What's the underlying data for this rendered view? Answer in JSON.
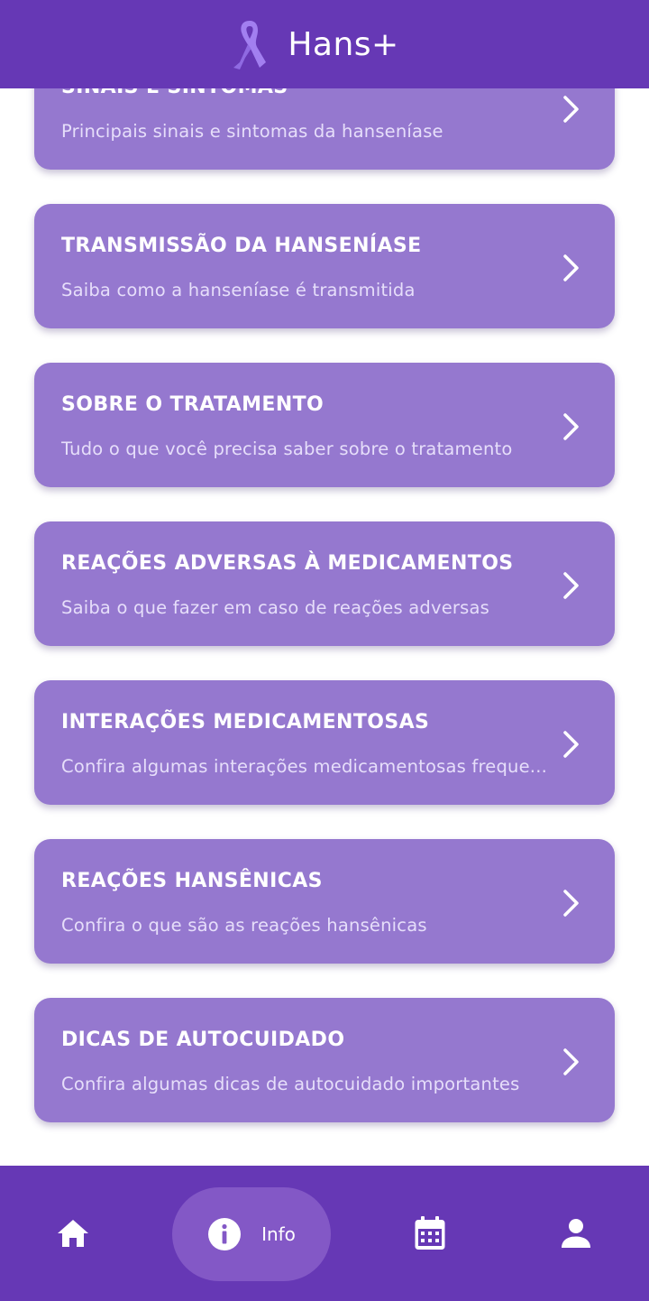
{
  "app": {
    "title": "Hans+",
    "ribbon_icon": "awareness-ribbon-icon",
    "colors": {
      "header_bg": "#6638b5",
      "card_bg": "#9578cf",
      "ribbon": "#a27ff0",
      "active_tab_bg": "#8358c6"
    }
  },
  "cards": [
    {
      "title": "SINAIS E SINTOMAS",
      "subtitle": "Principais sinais e sintomas da hanseníase"
    },
    {
      "title": "TRANSMISSÃO DA HANSENÍASE",
      "subtitle": "Saiba como a hanseníase é transmitida"
    },
    {
      "title": "SOBRE O TRATAMENTO",
      "subtitle": "Tudo o que você precisa saber sobre o tratamento"
    },
    {
      "title": "REAÇÕES ADVERSAS À MEDICAMENTOS",
      "subtitle": "Saiba o que fazer em caso de reações adversas"
    },
    {
      "title": "INTERAÇÕES MEDICAMENTOSAS",
      "subtitle": "Confira algumas interações medicamentosas freque..."
    },
    {
      "title": "REAÇÕES HANSÊNICAS",
      "subtitle": "Confira o que são as reações hansênicas"
    },
    {
      "title": "DICAS DE AUTOCUIDADO",
      "subtitle": "Confira algumas dicas de autocuidado importantes"
    }
  ],
  "bottom_nav": {
    "items": [
      {
        "icon": "home-icon",
        "label": ""
      },
      {
        "icon": "info-icon",
        "label": "Info",
        "active": true
      },
      {
        "icon": "calendar-icon",
        "label": ""
      },
      {
        "icon": "person-icon",
        "label": ""
      }
    ]
  }
}
